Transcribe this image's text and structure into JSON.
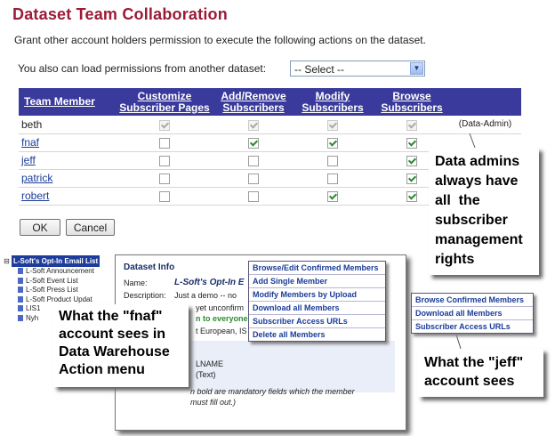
{
  "page": {
    "title": "Dataset Team Collaboration",
    "intro": "Grant other account holders permission to execute the following actions on the dataset.",
    "load_label": "You also can load permissions from another dataset:",
    "load_select_value": "-- Select --"
  },
  "table": {
    "headers": {
      "member": "Team Member",
      "customize_1": "Customize",
      "customize_2": "Subscriber Pages",
      "addremove_1": "Add/Remove",
      "addremove_2": "Subscribers",
      "modify_1": "Modify",
      "modify_2": "Subscribers",
      "browse_1": "Browse",
      "browse_2": "Subscribers"
    },
    "rows": [
      {
        "name": "beth",
        "customize": true,
        "addremove": true,
        "modify": true,
        "browse": true,
        "role": "(Data-Admin)"
      },
      {
        "name": "fnaf",
        "customize": false,
        "addremove": true,
        "modify": true,
        "browse": true,
        "role": ""
      },
      {
        "name": "jeff",
        "customize": false,
        "addremove": false,
        "modify": false,
        "browse": true,
        "role": ""
      },
      {
        "name": "patrick",
        "customize": false,
        "addremove": false,
        "modify": false,
        "browse": true,
        "role": ""
      },
      {
        "name": "robert",
        "customize": false,
        "addremove": false,
        "modify": true,
        "browse": true,
        "role": ""
      }
    ]
  },
  "buttons": {
    "ok": "OK",
    "cancel": "Cancel"
  },
  "callouts": {
    "admins": [
      "Data admins",
      "always have",
      "all  the",
      "subscriber",
      "management",
      "rights"
    ],
    "fnaf": [
      "What the \"fnaf\"",
      "account sees in",
      "Data Warehouse",
      "Action menu"
    ],
    "jeff": [
      "What the \"jeff\"",
      "account sees"
    ]
  },
  "tree": {
    "root": "L-Soft's Opt-In Email List",
    "items": [
      "L-Soft Announcement",
      "L-Soft Event List",
      "L-Soft Press List",
      "L-Soft Product Updat",
      "LIS1",
      "Nyh"
    ]
  },
  "dataset_info": {
    "title": "Dataset Info",
    "name_label": "Name:",
    "name_value": "L-Soft's Opt-In E",
    "desc_label": "Description:",
    "desc_value": "Just a demo -- no",
    "line3": "yet unconfirm",
    "line4": "n to everyone",
    "line5": "t European, IS",
    "line6": "LNAME",
    "line7": "(Text)",
    "line8": "n bold are mandatory fields which the member",
    "line9": "must fill out.)"
  },
  "fnaf_menu": [
    "Browse/Edit Confirmed Members",
    "Add Single Member",
    "Modify Members by Upload",
    "Download all Members",
    "Subscriber Access URLs",
    "Delete all Members"
  ],
  "jeff_menu": [
    "Browse Confirmed Members",
    "Download all Members",
    "Subscriber Access URLs"
  ]
}
